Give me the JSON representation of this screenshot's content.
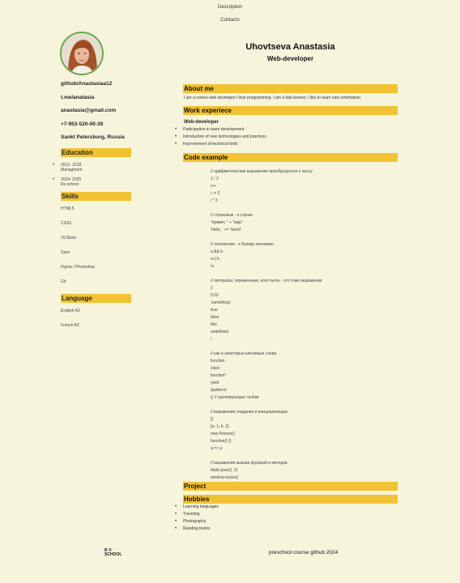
{
  "nav": [
    "Description",
    "Contacts"
  ],
  "header": {
    "name": "Uhovtseva Anastasia",
    "role": "Web-developer"
  },
  "contacts": [
    "github/Anastasiaa12",
    "t.me/anatasia",
    "anastasia@gmail.com",
    "+7-953-520-00-39",
    "Sankt Petersburg, Russia"
  ],
  "education": {
    "title": "Education",
    "items": [
      {
        "years": "2012- 2018",
        "place": "Managment"
      },
      {
        "years": "2024- 2025",
        "place": "Rs school"
      }
    ]
  },
  "skills": {
    "title": "Skills",
    "items": [
      "HTML5",
      "CSS3",
      "JS Basic",
      "Sass",
      "Figma / Photoshop",
      "Git"
    ]
  },
  "language": {
    "title": "Language",
    "items": [
      "English A2",
      "French A2"
    ]
  },
  "about": {
    "title": "About me",
    "text": "I am a novice web developer.I love programming. I am a fast learner, I like to learn new information."
  },
  "work": {
    "title": "Work experiece",
    "role": "Web-developer",
    "items": [
      "Participation in team development",
      "Introduction of new technologies and practices",
      "Improvement of technical tools"
    ]
  },
  "code": {
    "title": "Code example",
    "lines": [
      "// арифметические выражения преобразуются к числу",
      "1 / 2",
      "i++",
      "i -= 2",
      "i * 2",
      "",
      "// строковые - к строке",
      "\"привет, \" + \"мир\"",
      "'hello, ' += 'world'",
      "",
      "// логические - к булеву значению",
      "a && b",
      "a || b",
      "!a",
      "",
      "// литералы, переменные, константы - это тоже выражения",
      "2",
      "0.02",
      "'something'",
      "true",
      "false",
      "this",
      "undefined",
      "i",
      "",
      "// как и некоторые ключевые слова",
      "function",
      "class",
      "function*",
      "yield",
      "/pattern/i",
      "() // группирующие скобки",
      "",
      "// выражения создания и инициализации",
      "[]",
      "{a: 1, b: 2}",
      "new Person()",
      "function() {}",
      "a => a",
      "",
      "// выражения вызова функций и методов",
      "Math.pow(2, 2)",
      "window.resize()"
    ]
  },
  "project": {
    "title": "Project"
  },
  "hobbies": {
    "title": "Hobbies",
    "items": [
      "Learning languages",
      "Traveling",
      "Photography",
      "Reading books"
    ]
  },
  "footer": {
    "logo_line1": "R  ®",
    "logo_line2": "SCHOOL",
    "text": "preschool course  github  2024"
  }
}
